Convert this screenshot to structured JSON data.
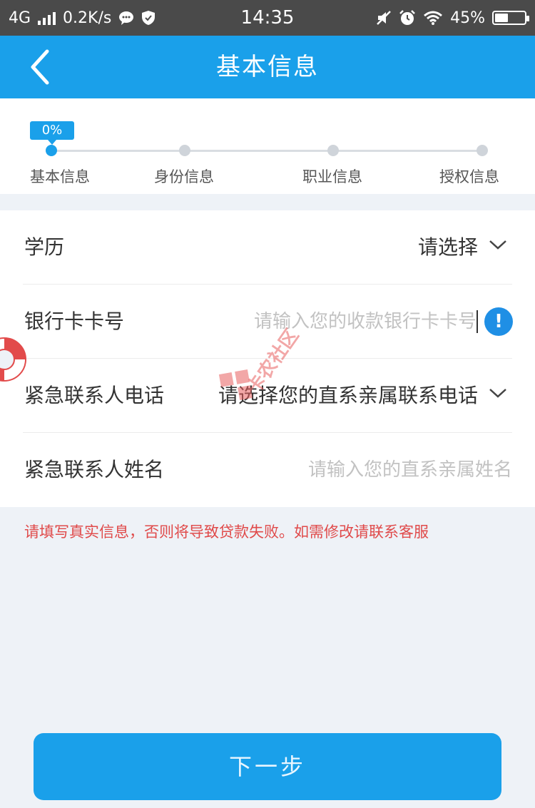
{
  "status_bar": {
    "network": "4G",
    "speed": "0.2K/s",
    "time": "14:35",
    "battery": "45%",
    "battery_level": 0.45,
    "icons": [
      "signal-icon",
      "chat-icon",
      "shield-icon",
      "mute-icon",
      "alarm-icon",
      "wifi-icon",
      "battery-icon"
    ]
  },
  "header": {
    "title": "基本信息",
    "back_icon": "chevron-left-icon"
  },
  "progress": {
    "percent_label": "0%",
    "percent": 0,
    "steps": [
      {
        "label": "基本信息",
        "active": true
      },
      {
        "label": "身份信息",
        "active": false
      },
      {
        "label": "职业信息",
        "active": false
      },
      {
        "label": "授权信息",
        "active": false
      }
    ]
  },
  "form": {
    "education": {
      "label": "学历",
      "value": "请选择"
    },
    "bank_card": {
      "label": "银行卡卡号",
      "placeholder": "请输入您的收款银行卡卡号",
      "info_icon": "!"
    },
    "emergency_phone": {
      "label": "紧急联系人电话",
      "value": "请选择您的直系亲属联系电话"
    },
    "emergency_name": {
      "label": "紧急联系人姓名",
      "placeholder": "请输入您的直系亲属姓名"
    }
  },
  "notice": "请填写真实信息，否则将导致贷款失败。如需修改请联系客服",
  "next_button": "下一步",
  "watermark": "卡农社区",
  "colors": {
    "primary": "#1aa0ea",
    "status_bar": "#4a4a4a",
    "notice": "#e04a4a",
    "background": "#eef2f7"
  }
}
